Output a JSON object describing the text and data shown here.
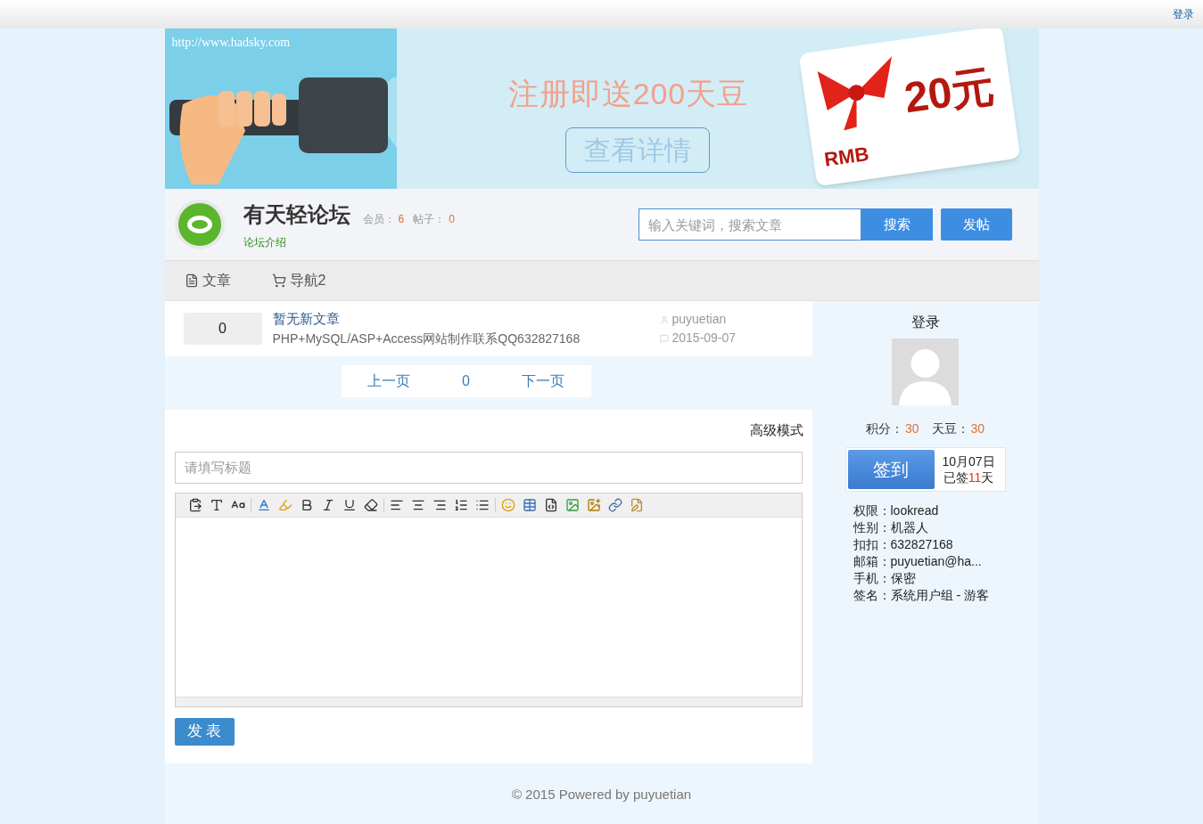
{
  "topbar": {
    "login": "登录"
  },
  "banner": {
    "url": "http://www.hadsky.com",
    "headline": "注册即送200天豆",
    "button": "查看详情",
    "card_currency": "RMB",
    "card_amount": "20元"
  },
  "header": {
    "site_name": "有天轻论坛",
    "members_label": "会员：",
    "members": "6",
    "posts_label": "帖子：",
    "posts": "0",
    "intro_link": "论坛介绍",
    "search": {
      "placeholder": "输入关键词，搜索文章"
    },
    "search_button": "搜索",
    "post_button": "发帖"
  },
  "nav": [
    {
      "kind": "document",
      "label": "文章"
    },
    {
      "kind": "cart",
      "label": "导航2"
    }
  ],
  "articles": [
    {
      "count": "0",
      "title": "暂无新文章",
      "summary": "PHP+MySQL/ASP+Access网站制作联系QQ632827168",
      "author": "puyuetian",
      "date": "2015-09-07"
    }
  ],
  "pager": {
    "prev": "上一页",
    "page": "0",
    "next": "下一页"
  },
  "editor": {
    "mode_link": "高级模式",
    "title": {
      "placeholder": "请填写标题"
    },
    "submit": "发 表",
    "tools": [
      [
        {
          "kind": "paste"
        },
        {
          "kind": "font"
        },
        {
          "kind": "size"
        }
      ],
      [
        {
          "kind": "color"
        },
        {
          "kind": "highlight"
        },
        {
          "kind": "bold"
        },
        {
          "kind": "italic"
        },
        {
          "kind": "underline"
        },
        {
          "kind": "eraser"
        }
      ],
      [
        {
          "kind": "left"
        },
        {
          "kind": "center"
        },
        {
          "kind": "right"
        },
        {
          "kind": "ordered"
        },
        {
          "kind": "bullet"
        }
      ],
      [
        {
          "kind": "smile"
        },
        {
          "kind": "table"
        },
        {
          "kind": "code"
        },
        {
          "kind": "image"
        },
        {
          "kind": "image-add"
        },
        {
          "kind": "link"
        },
        {
          "kind": "edit"
        }
      ]
    ]
  },
  "sidebar": {
    "login": "登录",
    "points_label": "积分：",
    "points": "30",
    "beans_label": "天豆：",
    "beans": "30",
    "checkin_button": "签到",
    "checkin_date": "10月07日",
    "checkin_prefix": "已签",
    "checkin_days": "11",
    "checkin_suffix": "天",
    "info": [
      {
        "label": "权限：",
        "value": "lookread"
      },
      {
        "label": "性别：",
        "value": "机器人"
      },
      {
        "label": "扣扣：",
        "value": "632827168"
      },
      {
        "label": "邮箱：",
        "value": "puyuetian@ha..."
      },
      {
        "label": "手机：",
        "value": "保密"
      },
      {
        "label": "签名：",
        "value": "系统用户组 - 游客"
      }
    ]
  },
  "footer": "© 2015 Powered by puyuetian"
}
